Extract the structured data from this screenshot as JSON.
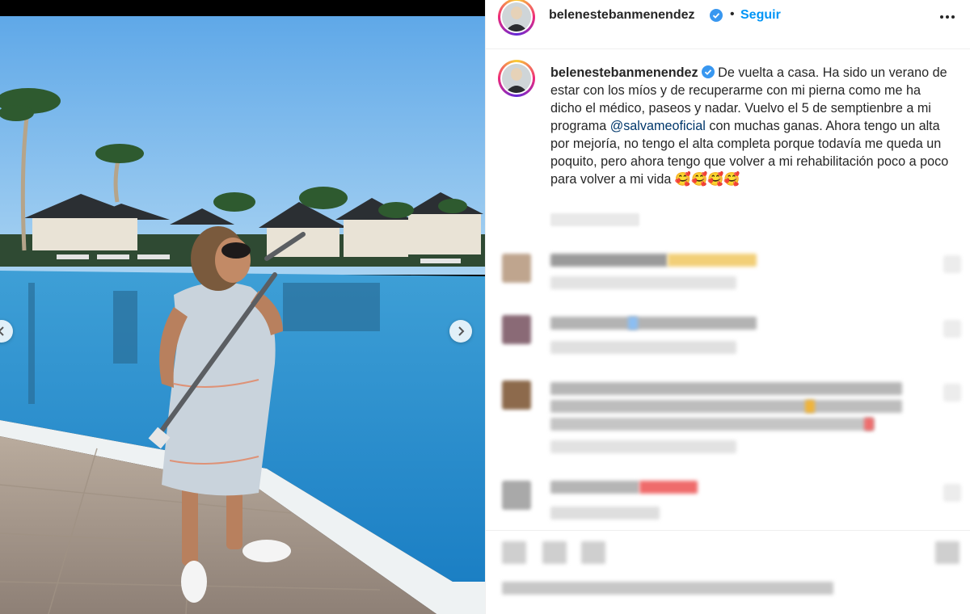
{
  "post": {
    "username": "belenestebanmenendez",
    "follow_label": "Seguir",
    "header_separator": "•",
    "caption": {
      "username": "belenestebanmenendez",
      "text_part1": "De vuelta a casa. Ha sido un verano de estar con los míos y de recuperarme con mi pierna como me ha dicho el médico, paseos y nadar. Vuelvo el 5 de semptienbre a mi programa ",
      "mention": "@salvameoficial",
      "text_part2": " con muchas ganas. Ahora tengo un alta por mejoría, no tengo el alta completa porque todavía me queda un poquito, pero ahora tengo que volver a mi rehabilitación poco a poco para volver a mi vida 🥰🥰🥰🥰"
    }
  },
  "icons": {
    "verified": "verified-badge-icon",
    "more": "more-options-icon",
    "prev": "chevron-left-icon",
    "next": "chevron-right-icon"
  },
  "colors": {
    "accent": "#0095f6",
    "verified": "#3897f0",
    "mention": "#00376b",
    "text": "#262626"
  }
}
